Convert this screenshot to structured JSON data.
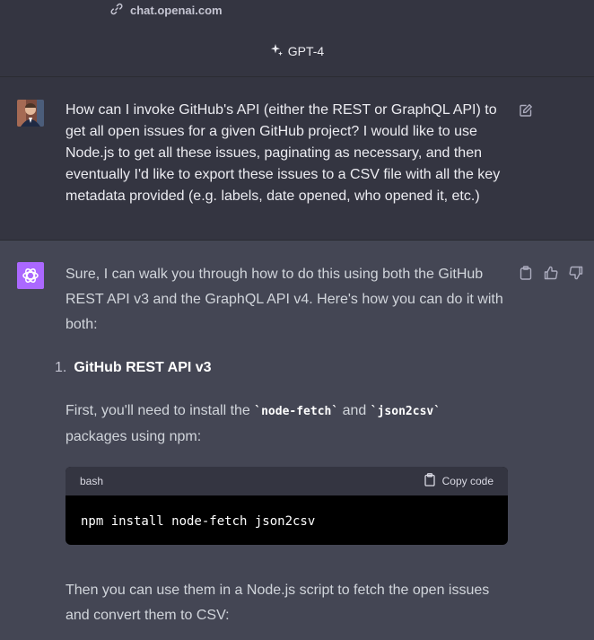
{
  "header": {
    "url": "chat.openai.com",
    "model": "GPT-4"
  },
  "user_message": {
    "text": "How can I invoke GitHub's API (either the REST or GraphQL API) to get all open issues for a given GitHub project? I would like to use Node.js to get all these issues, paginating as necessary, and then eventually I'd like to export these issues to a CSV file with all the key metadata provided (e.g. labels, date opened, who opened it, etc.)"
  },
  "assistant_message": {
    "intro": "Sure, I can walk you through how to do this using both the GitHub REST API v3 and the GraphQL API v4. Here's how you can do it with both:",
    "list_number": "1.",
    "list_title": "GitHub REST API v3",
    "install_prefix": "First, you'll need to install the ",
    "pkg1": "`node-fetch`",
    "install_and": " and ",
    "pkg2": "`json2csv`",
    "install_suffix": " packages using npm:",
    "code": {
      "language": "bash",
      "copy_label": "Copy code",
      "content": "npm install node-fetch json2csv"
    },
    "followup": "Then you can use them in a Node.js script to fetch the open issues and convert them to CSV:"
  },
  "colors": {
    "user_bg": "#343541",
    "assistant_bg": "#444654",
    "gpt_avatar": "#ab68ff"
  }
}
